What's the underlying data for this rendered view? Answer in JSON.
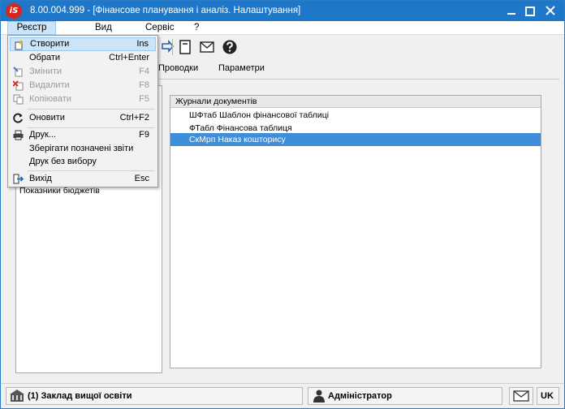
{
  "window": {
    "title": "8.00.004.999 - [Фінансове планування і аналіз. Налаштування]",
    "logo_text": "iS"
  },
  "menubar": {
    "items": [
      {
        "label": "Реєстр"
      },
      {
        "label": "Вид"
      },
      {
        "label": "Сервіс"
      },
      {
        "label": "?"
      }
    ]
  },
  "tabs": [
    {
      "label": "Проводки"
    },
    {
      "label": "Параметри"
    }
  ],
  "left_panel": {
    "items": [
      {
        "label": "Показники бюджетів"
      }
    ]
  },
  "document_list": {
    "header": "Журнали документів",
    "rows": [
      {
        "label": "ШФтаб Шаблон фінансової таблиці",
        "selected": false
      },
      {
        "label": "ФТабл Фінансова таблиця",
        "selected": false
      },
      {
        "label": "СкМрп Наказ кошторису",
        "selected": true
      }
    ]
  },
  "dropdown": {
    "items": [
      {
        "label": "Створити",
        "shortcut": "Ins",
        "icon": "create-icon",
        "state": "highlighted"
      },
      {
        "label": "Обрати",
        "shortcut": "Ctrl+Enter",
        "icon": "",
        "state": "enabled"
      },
      {
        "label": "Змінити",
        "shortcut": "F4",
        "icon": "edit-icon",
        "state": "disabled"
      },
      {
        "label": "Видалити",
        "shortcut": "F8",
        "icon": "delete-icon",
        "state": "disabled"
      },
      {
        "label": "Копіювати",
        "shortcut": "F5",
        "icon": "copy-icon",
        "state": "disabled"
      },
      {
        "label": "Оновити",
        "shortcut": "Ctrl+F2",
        "icon": "refresh-icon",
        "state": "enabled"
      },
      {
        "label": "Друк...",
        "shortcut": "F9",
        "icon": "print-icon",
        "state": "enabled"
      },
      {
        "label": "Зберігати позначені звіти",
        "shortcut": "",
        "icon": "",
        "state": "enabled"
      },
      {
        "label": "Друк без вибору",
        "shortcut": "",
        "icon": "",
        "state": "enabled"
      },
      {
        "label": "Вихід",
        "shortcut": "Esc",
        "icon": "exit-icon",
        "state": "enabled"
      }
    ]
  },
  "statusbar": {
    "organization": "(1) Заклад вищої освіти",
    "user": "Адміністратор",
    "language": "UK"
  },
  "colors": {
    "titlebar": "#1f77c9",
    "selection": "#3f8edc",
    "menu_highlight": "#cce4f7",
    "logo": "#d9261c"
  }
}
